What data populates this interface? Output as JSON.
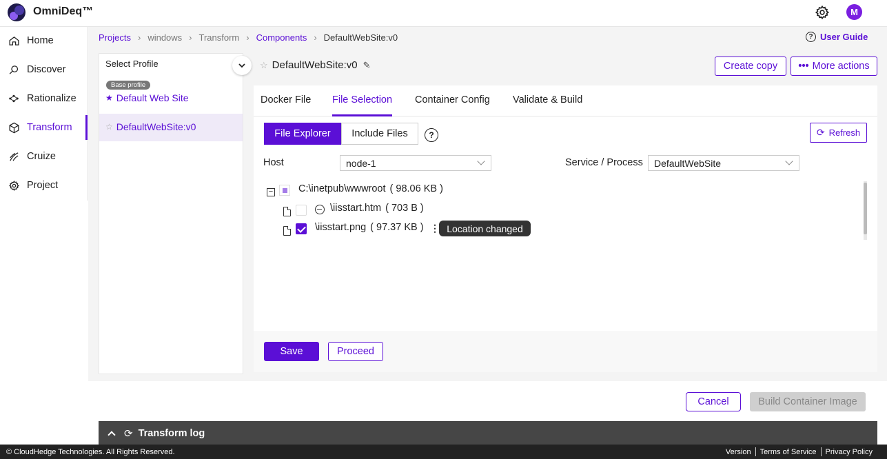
{
  "app": {
    "name": "OmniDeq™",
    "avatar_initial": "M"
  },
  "sidebar": {
    "items": [
      {
        "label": "Home",
        "icon": "home-icon"
      },
      {
        "label": "Discover",
        "icon": "discover-icon"
      },
      {
        "label": "Rationalize",
        "icon": "rationalize-icon"
      },
      {
        "label": "Transform",
        "icon": "transform-icon",
        "active": true
      },
      {
        "label": "Cruize",
        "icon": "cruize-icon"
      },
      {
        "label": "Project",
        "icon": "project-gear-icon"
      }
    ]
  },
  "breadcrumb": [
    "Projects",
    "windows",
    "Transform",
    "Components",
    "DefaultWebSite:v0"
  ],
  "user_guide": "User Guide",
  "profiles": {
    "select_label": "Select Profile",
    "base_badge": "Base profile",
    "items": [
      "Default Web Site",
      "DefaultWebSite:v0"
    ]
  },
  "component": {
    "title": "DefaultWebSite:v0",
    "create_copy": "Create copy",
    "more_actions": "More actions"
  },
  "tabs": [
    "Docker File",
    "File Selection",
    "Container Config",
    "Validate & Build"
  ],
  "active_tab": "File Selection",
  "file_selection": {
    "segments": [
      "File Explorer",
      "Include Files"
    ],
    "refresh": "Refresh",
    "host_label": "Host",
    "host_value": "node-1",
    "service_label": "Service / Process",
    "service_value": "DefaultWebSite",
    "tree": {
      "root": {
        "name": "C:\\inetpub\\wwwroot",
        "size": "( 98.06 KB )"
      },
      "children": [
        {
          "name": "\\iisstart.htm",
          "size": "( 703 B )",
          "checked": false
        },
        {
          "name": "\\iisstart.png",
          "size": "( 97.37 KB )",
          "checked": true,
          "badge": "Location changed"
        }
      ]
    },
    "save": "Save",
    "proceed": "Proceed"
  },
  "actions": {
    "cancel": "Cancel",
    "build": "Build Container Image"
  },
  "log": {
    "title": "Transform log"
  },
  "footer": {
    "copyright": "© CloudHedge Technologies. All Rights Reserved.",
    "links": [
      "Version",
      "Terms of Service",
      "Privacy Policy"
    ]
  },
  "colors": {
    "accent": "#5b0fd6",
    "log_bar": "#464646",
    "footer": "#222222"
  }
}
